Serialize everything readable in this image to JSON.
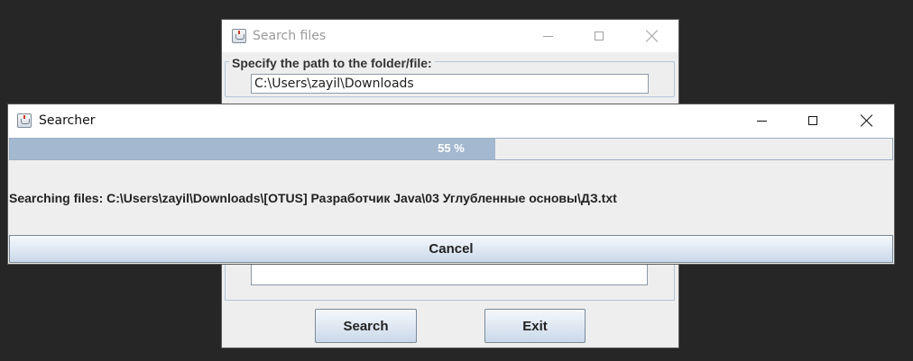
{
  "search_window": {
    "title": "Search files",
    "path_group_label": "Specify the path to the folder/file:",
    "path_value": "C:\\Users\\zayil\\Downloads",
    "search_label": "Search",
    "exit_label": "Exit"
  },
  "searcher_dialog": {
    "title": "Searcher",
    "progress_text": "55 %",
    "progress_value": 0.55,
    "status_text": "Searching files: C:\\Users\\zayil\\Downloads\\[OTUS] Разработчик Java\\03 Углубленные основы\\ДЗ.txt",
    "cancel_label": "Cancel"
  },
  "colors": {
    "desktop": "#262626",
    "progress_fill": "#a4b9cf",
    "progress_track": "#eeeeee"
  },
  "icons": [
    "java-app-icon",
    "minimize-icon",
    "maximize-icon",
    "close-icon"
  ]
}
